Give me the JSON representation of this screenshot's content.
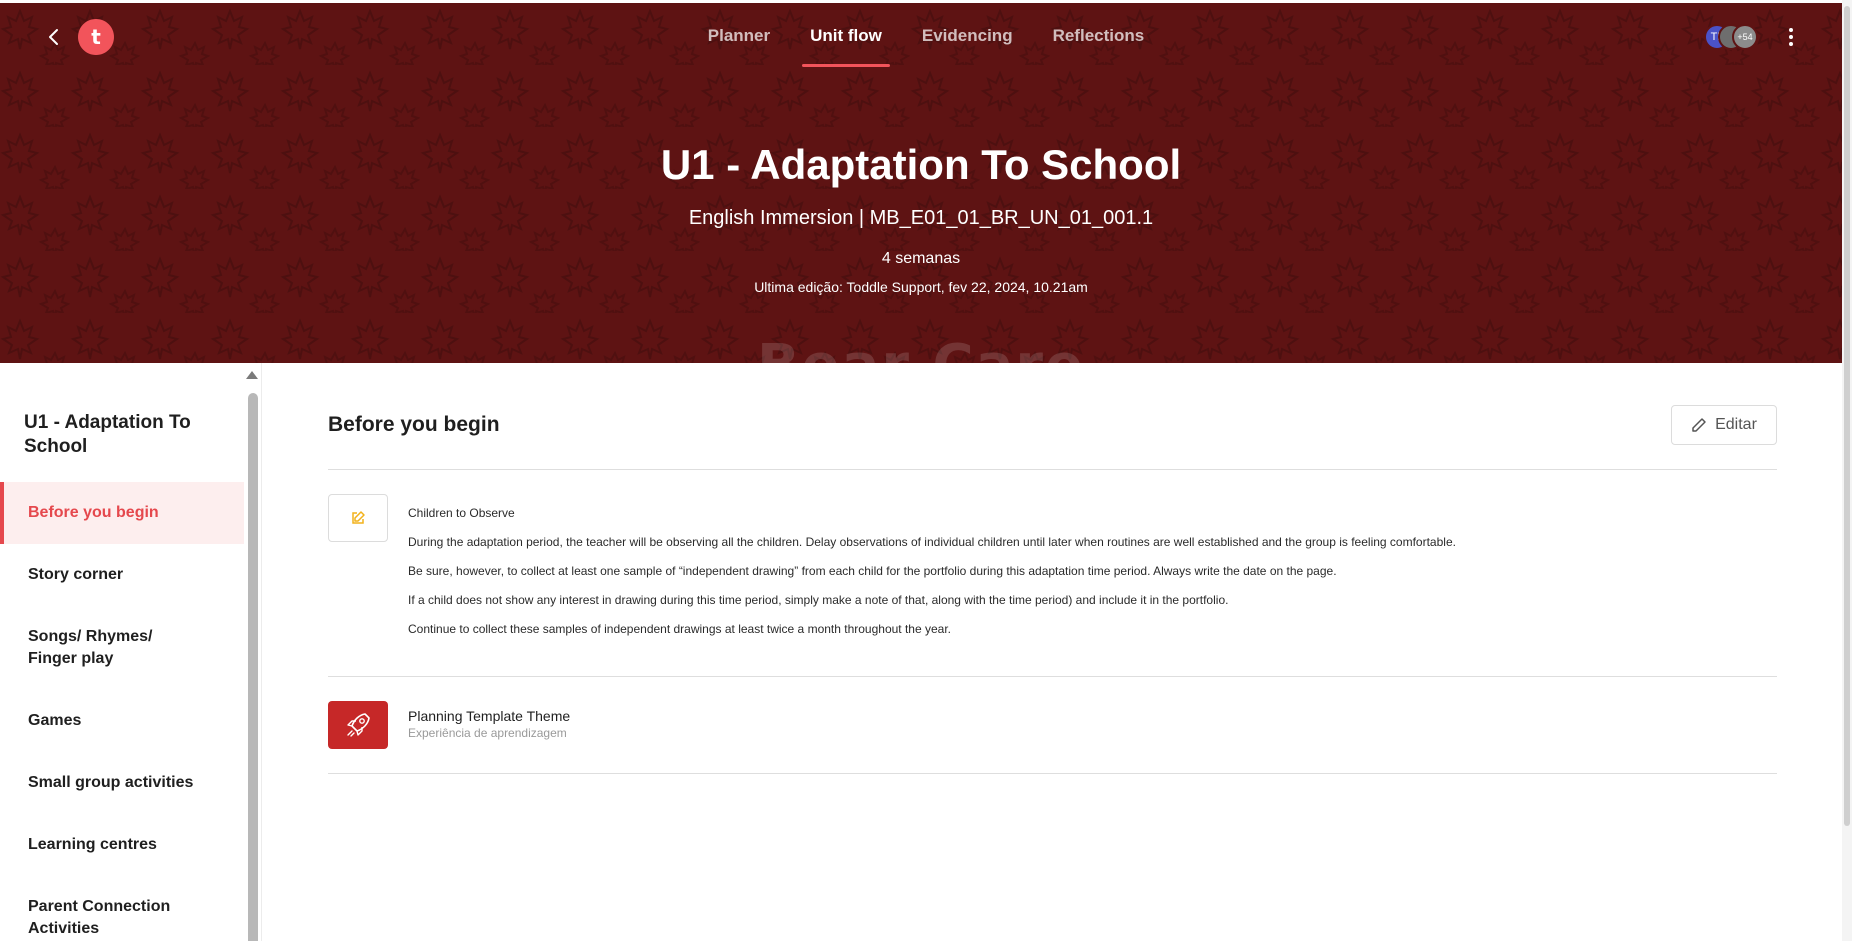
{
  "nav": {
    "tabs": [
      {
        "label": "Planner"
      },
      {
        "label": "Unit flow"
      },
      {
        "label": "Evidencing"
      },
      {
        "label": "Reflections"
      }
    ],
    "active_tab": "Unit flow",
    "avatars": [
      {
        "text": "TL"
      },
      {
        "text": ""
      },
      {
        "text": "+54"
      }
    ]
  },
  "hero": {
    "title": "U1 - Adaptation To School",
    "subtitle": "English Immersion | MB_E01_01_BR_UN_01_001.1",
    "duration": "4 semanas",
    "last_edit": "Ultima edição: Toddle Support, fev 22, 2024, 10.21am",
    "background_color": "#5e1313"
  },
  "sidebar": {
    "title": "U1 - Adaptation To School",
    "items": [
      {
        "label": "Before you begin"
      },
      {
        "label": "Story corner"
      },
      {
        "label": "Songs/ Rhymes/ Finger play"
      },
      {
        "label": "Games"
      },
      {
        "label": "Small group activities"
      },
      {
        "label": "Learning centres"
      },
      {
        "label": "Parent Connection Activities"
      }
    ]
  },
  "main": {
    "title": "Before you begin",
    "edit_label": "Editar",
    "note": {
      "lines": [
        "Children to Observe",
        "During the adaptation period, the teacher will be observing all  the children. Delay observations of individual children until  later when routines are well established and the group is feeling  comfortable.",
        "Be sure, however, to collect at least one sample of “independent  drawing” from each child for the portfolio during this  adaptation time period. Always write the date on the page.",
        "If a child does not show any interest in drawing during this time  period, simply make a note of that, along with the time period) and include it in the portfolio.",
        "Continue to collect these samples of independent drawings at  least twice a month throughout the year."
      ]
    },
    "theme": {
      "title": "Planning Template Theme",
      "subtitle": "Experiência de aprendizagem"
    }
  },
  "colors": {
    "accent": "#e5484d",
    "tab_indicator": "#f2545b",
    "theme_tile": "#c62828",
    "note_icon": "#f2b21b"
  }
}
